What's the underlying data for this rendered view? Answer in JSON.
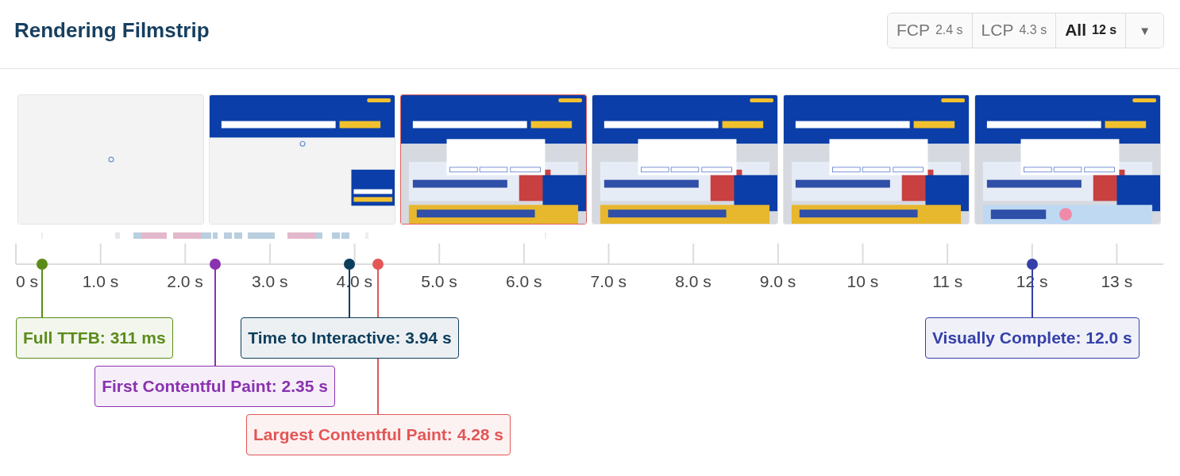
{
  "header": {
    "title": "Rendering Filmstrip",
    "filters": [
      {
        "label": "FCP",
        "value": "2.4 s",
        "selected": false
      },
      {
        "label": "LCP",
        "value": "4.3 s",
        "selected": false
      },
      {
        "label": "All",
        "value": "12 s",
        "selected": true
      }
    ],
    "dropdown": "▼"
  },
  "frames": [
    {
      "kind": "blank",
      "highlighted": false
    },
    {
      "kind": "loading",
      "highlighted": false
    },
    {
      "kind": "popup",
      "highlighted": true
    },
    {
      "kind": "popup",
      "highlighted": false
    },
    {
      "kind": "popup",
      "highlighted": false
    },
    {
      "kind": "popup-alt",
      "highlighted": false
    }
  ],
  "timeline": {
    "ticks": [
      "0 s",
      "1.0 s",
      "2.0 s",
      "3.0 s",
      "4.0 s",
      "5.0 s",
      "6.0 s",
      "7.0 s",
      "8.0 s",
      "9.0 s",
      "10 s",
      "11 s",
      "12 s",
      "13 s"
    ],
    "milestones": [
      {
        "label": "Full TTFB: 311 ms",
        "color": "#5b8c1a",
        "level": 0.023
      },
      {
        "label": "First Contentful Paint: 2.35 s",
        "color": "#8a32b0",
        "level": 0.1735
      },
      {
        "label": "Time to Interactive: 3.94 s",
        "color": "#0d3d5c",
        "level": 0.2908
      },
      {
        "label": "Largest Contentful Paint: 4.28 s",
        "color": "#e35656",
        "level": 0.3159
      },
      {
        "label": "Visually Complete: 12.0 s",
        "color": "#3540a8",
        "level": 0.8858
      }
    ]
  }
}
